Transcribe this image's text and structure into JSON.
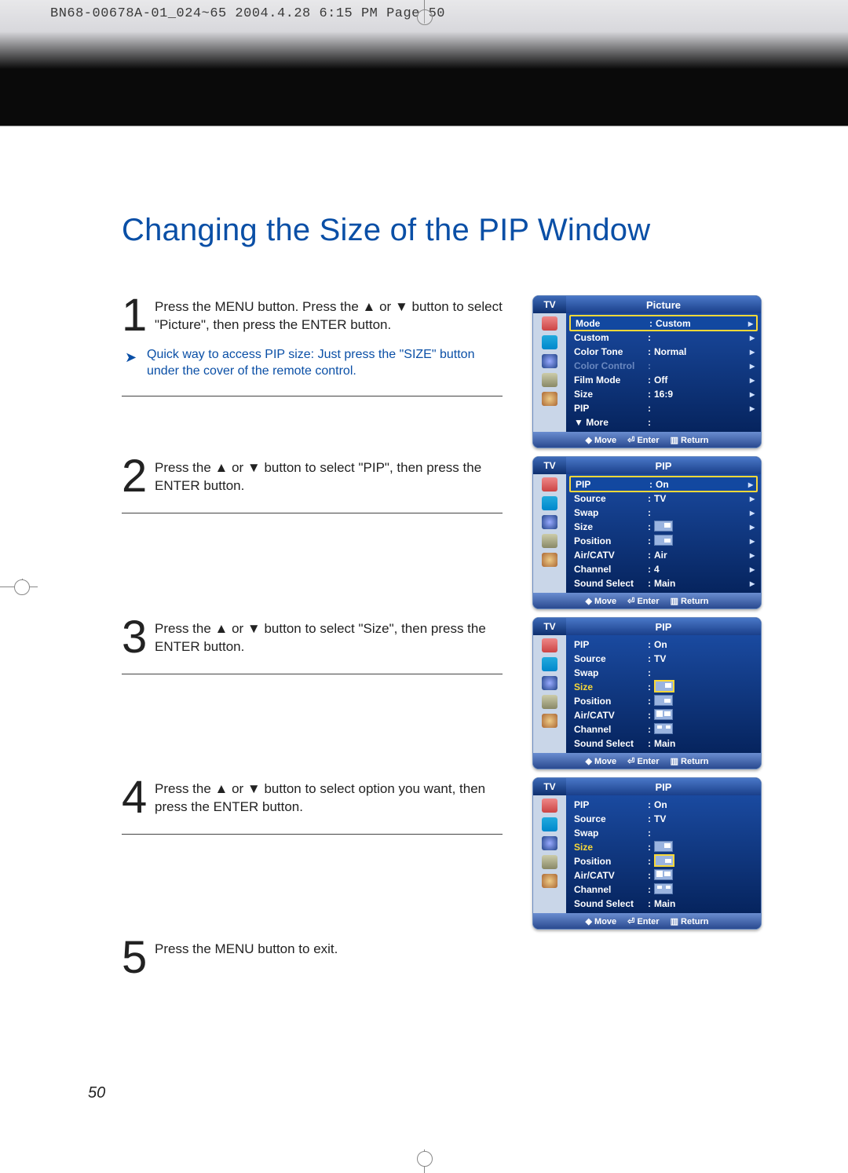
{
  "print_header": "BN68-00678A-01_024~65  2004.4.28  6:15 PM  Page 50",
  "title": "Changing the Size of the PIP Window",
  "page_num": "50",
  "steps": [
    {
      "num": "1",
      "text_a": "Press the MENU button. Press the ",
      "text_b": " or ",
      "text_c": " button to select \"Picture\", then press the ENTER button.",
      "tip": "Quick way to access PIP size: Just press the \"SIZE\" button under the cover of the remote control."
    },
    {
      "num": "2",
      "text_a": "Press the ",
      "text_b": " or ",
      "text_c": " button to select \"PIP\", then press the ENTER button."
    },
    {
      "num": "3",
      "text_a": "Press the ",
      "text_b": " or ",
      "text_c": " button to select \"Size\", then press the ENTER button."
    },
    {
      "num": "4",
      "text_a": "Press the ",
      "text_b": " or ",
      "text_c": " button to select option you want, then press the ENTER button."
    },
    {
      "num": "5",
      "text_a": "Press the MENU button to exit."
    }
  ],
  "osd_foot": {
    "move": "Move",
    "enter": "Enter",
    "return": "Return"
  },
  "osd_tv": "TV",
  "osd1": {
    "title": "Picture",
    "rows": [
      {
        "k": "Mode",
        "v": "Custom",
        "hl": true,
        "ar": true
      },
      {
        "k": "Custom",
        "v": "",
        "ar": true
      },
      {
        "k": "Color Tone",
        "v": "Normal",
        "ar": true
      },
      {
        "k": "Color Control",
        "v": "",
        "dim": true,
        "ar": true
      },
      {
        "k": "Film Mode",
        "v": "Off",
        "ar": true
      },
      {
        "k": "Size",
        "v": "16:9",
        "ar": true
      },
      {
        "k": "PIP",
        "v": "",
        "ar": true
      },
      {
        "k": "▼ More",
        "v": ""
      }
    ]
  },
  "osd2": {
    "title": "PIP",
    "rows": [
      {
        "k": "PIP",
        "v": "On",
        "hl": true,
        "ar": true
      },
      {
        "k": "Source",
        "v": "TV",
        "ar": true
      },
      {
        "k": "Swap",
        "v": "",
        "ar": true
      },
      {
        "k": "Size",
        "vbox": "a1",
        "ar": true
      },
      {
        "k": "Position",
        "vbox": "a2",
        "ar": true
      },
      {
        "k": "Air/CATV",
        "v": "Air",
        "ar": true
      },
      {
        "k": "Channel",
        "v": "4",
        "ar": true
      },
      {
        "k": "Sound Select",
        "v": "Main",
        "ar": true
      }
    ]
  },
  "osd3": {
    "title": "PIP",
    "rows": [
      {
        "k": "PIP",
        "v": "On"
      },
      {
        "k": "Source",
        "v": "TV"
      },
      {
        "k": "Swap",
        "v": ""
      },
      {
        "k": "Size",
        "sel": true,
        "vbox": "a1",
        "hlbox": true
      },
      {
        "k": "Position",
        "vbox": "a2"
      },
      {
        "k": "Air/CATV",
        "vbox": "dual"
      },
      {
        "k": "Channel",
        "vbox": "quad"
      },
      {
        "k": "Sound Select",
        "v": "Main"
      }
    ]
  },
  "osd4": {
    "title": "PIP",
    "rows": [
      {
        "k": "PIP",
        "v": "On"
      },
      {
        "k": "Source",
        "v": "TV"
      },
      {
        "k": "Swap",
        "v": ""
      },
      {
        "k": "Size",
        "sel": true,
        "vbox": "a1"
      },
      {
        "k": "Position",
        "vbox": "a2",
        "hlbox": true
      },
      {
        "k": "Air/CATV",
        "vbox": "dual"
      },
      {
        "k": "Channel",
        "vbox": "quad"
      },
      {
        "k": "Sound Select",
        "v": "Main"
      }
    ]
  }
}
